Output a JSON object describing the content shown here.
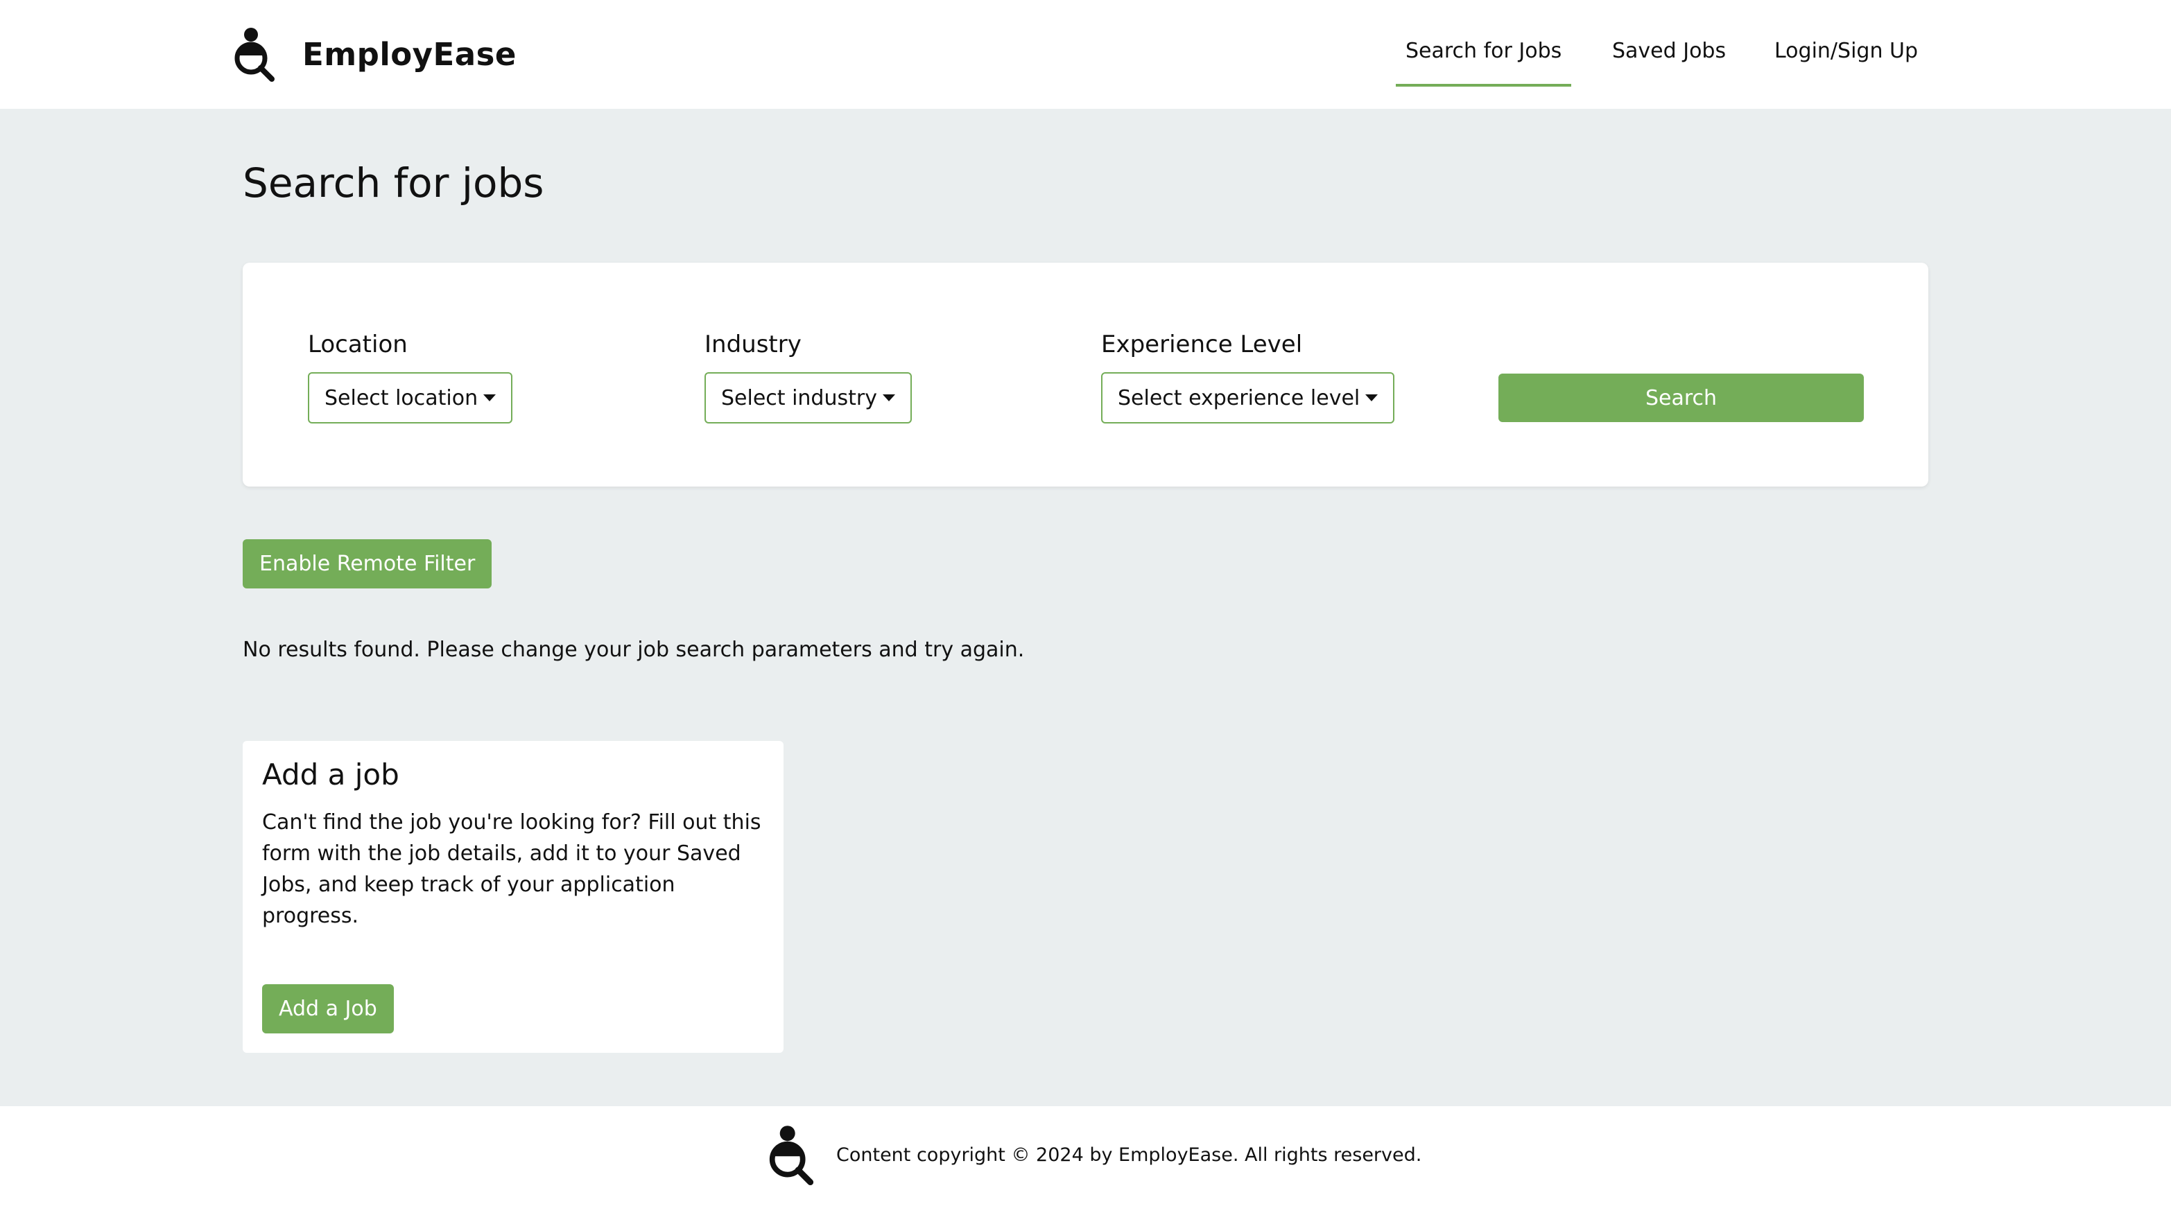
{
  "header": {
    "brand": "EmployEase",
    "nav": {
      "search": "Search for Jobs",
      "saved": "Saved Jobs",
      "login": "Login/Sign Up"
    }
  },
  "page": {
    "title": "Search for jobs"
  },
  "filters": {
    "location": {
      "label": "Location",
      "placeholder": "Select location"
    },
    "industry": {
      "label": "Industry",
      "placeholder": "Select industry"
    },
    "experience": {
      "label": "Experience Level",
      "placeholder": "Select experience level"
    },
    "search_label": "Search"
  },
  "remote_filter_label": "Enable Remote Filter",
  "results": {
    "message": "No results found. Please change your job search parameters and try again."
  },
  "add_job": {
    "title": "Add a job",
    "description": "Can't find the job you're looking for? Fill out this form with the job details, add it to your Saved Jobs, and keep track of your application progress.",
    "button_label": "Add a Job"
  },
  "footer": {
    "copyright": "Content copyright © 2024 by EmployEase. All rights reserved."
  },
  "colors": {
    "accent": "#74ad58",
    "background": "#eaeeef"
  }
}
